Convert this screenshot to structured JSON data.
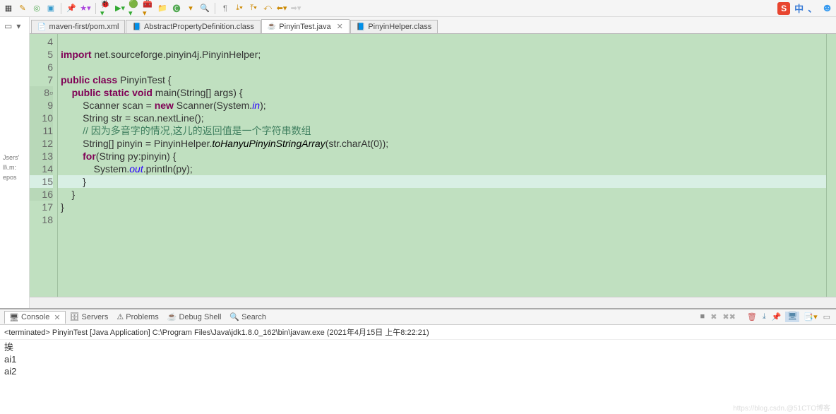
{
  "toolbar_right": {
    "s_label": "S",
    "cn": "中",
    "punct": "、",
    "face": "☻"
  },
  "sidebar_fragments": [
    "Jsers'",
    "ll\\.m:",
    "epos"
  ],
  "tabs": [
    {
      "icon": "📄",
      "label": "maven-first/pom.xml",
      "active": false
    },
    {
      "icon": "📘",
      "label": "AbstractPropertyDefinition.class",
      "active": false
    },
    {
      "icon": "☕",
      "label": "PinyinTest.java",
      "active": true,
      "close": "✕"
    },
    {
      "icon": "📘",
      "label": "PinyinHelper.class",
      "active": false
    }
  ],
  "code": {
    "lines": [
      {
        "n": "4",
        "cls": "",
        "html": ""
      },
      {
        "n": "5",
        "cls": "",
        "html": "<span class='kw'>import</span> net.sourceforge.pinyin4j.PinyinHelper;"
      },
      {
        "n": "6",
        "cls": "",
        "html": ""
      },
      {
        "n": "7",
        "cls": "",
        "html": "<span class='kw'>public class</span> PinyinTest {"
      },
      {
        "n": "8▫",
        "cls": "mark",
        "html": "    <span class='kw'>public static void</span> main(String[] args) {"
      },
      {
        "n": "9",
        "cls": "mark",
        "html": "        Scanner scan = <span class='kw'>new</span> Scanner(System.<span class='st'>in</span>);"
      },
      {
        "n": "10",
        "cls": "mark",
        "html": "        String str = scan.nextLine();"
      },
      {
        "n": "11",
        "cls": "mark",
        "html": "        <span class='cm'>// 因为多音字的情况,这儿的返回值是一个字符串数组</span>"
      },
      {
        "n": "12",
        "cls": "mark",
        "html": "        String[] pinyin = PinyinHelper.<span class='it'>toHanyuPinyinStringArray</span>(str.charAt(0));"
      },
      {
        "n": "13",
        "cls": "mark",
        "html": "        <span class='kw'>for</span>(String py:pinyin) {"
      },
      {
        "n": "14",
        "cls": "mark",
        "html": "            System.<span class='st'>out</span>.println(py);"
      },
      {
        "n": "15",
        "cls": "mark cursor-line",
        "html": "        }"
      },
      {
        "n": "16",
        "cls": "mark",
        "html": "    }"
      },
      {
        "n": "17",
        "cls": "",
        "html": "}"
      },
      {
        "n": "18",
        "cls": "",
        "html": ""
      }
    ]
  },
  "console_tabs": [
    {
      "icon": "🖥",
      "label": "Console",
      "active": true,
      "close": "✕"
    },
    {
      "icon": "🗄",
      "label": "Servers"
    },
    {
      "icon": "⚠",
      "label": "Problems"
    },
    {
      "icon": "☕",
      "label": "Debug Shell"
    },
    {
      "icon": "🔍",
      "label": "Search"
    }
  ],
  "console_header": "<terminated> PinyinTest [Java Application] C:\\Program Files\\Java\\jdk1.8.0_162\\bin\\javaw.exe (2021年4月15日 上午8:22:21)",
  "console_output": [
    "挨",
    "ai1",
    "ai2"
  ],
  "watermark": "https://blog.csdn.@51CTO博客"
}
